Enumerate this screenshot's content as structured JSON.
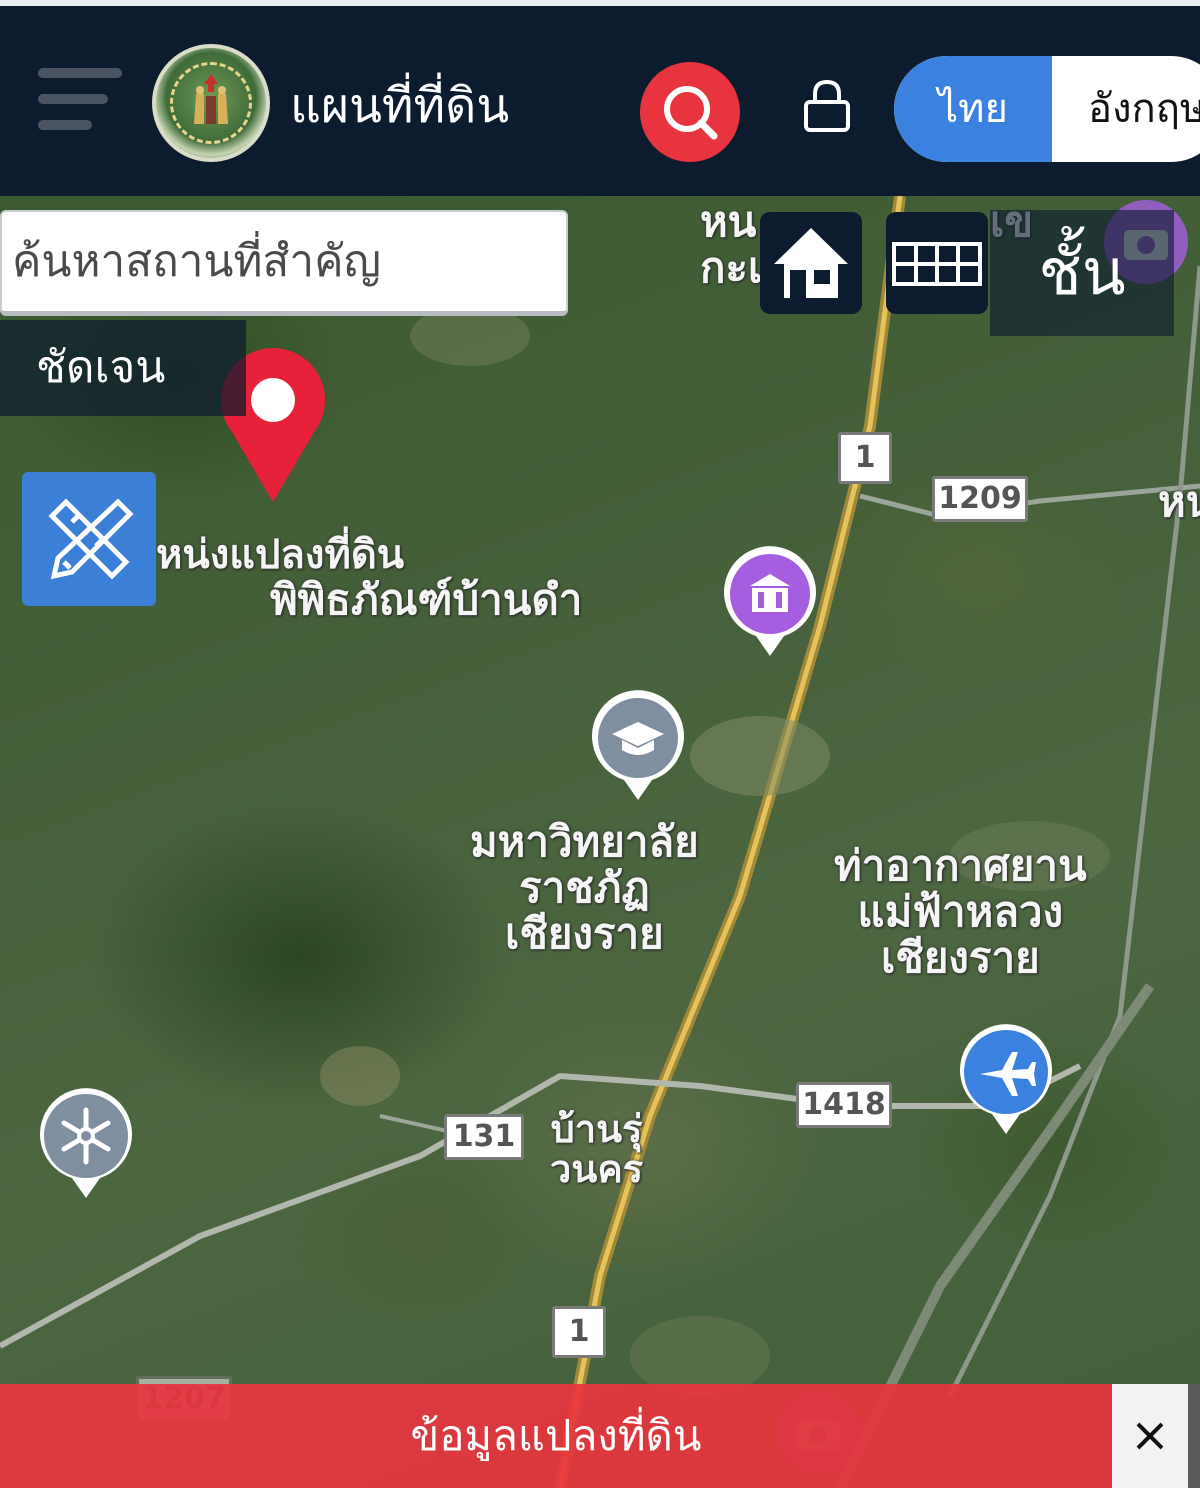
{
  "header": {
    "title": "แผนที่ที่ดิน",
    "logo_icon": "department-of-lands-seal",
    "search_icon": "search-icon",
    "lock_icon": "lock-icon",
    "language": {
      "active": "ไทย",
      "other": "อังกฤษ"
    }
  },
  "search": {
    "placeholder": "ค้นหาสถานที่สำคัญ"
  },
  "controls": {
    "clear_label": "ชัดเจน",
    "home_icon": "home-icon",
    "grid_icon": "grid-icon",
    "layers_label": "ชั้น",
    "measure_icon": "ruler-pencil-icon"
  },
  "map": {
    "pin_label": "หน่งแปลงที่ดิน",
    "labels": {
      "museum": "พิพิธภัณฑ์บ้านดำ",
      "university": [
        "มหาวิทยาลัย",
        "ราชภัฏ",
        "เชียงราย"
      ],
      "airport": [
        "ท่าอากาศยาน",
        "แม่ฟ้าหลวง",
        "เชียงราย"
      ],
      "village": [
        "บ้านรุ่",
        "วนคร"
      ],
      "top_partial": [
        "หน",
        "กะเ"
      ],
      "top_partial_right": "เข",
      "right_edge": "หน"
    },
    "road_shields": [
      "1",
      "1209",
      "1418",
      "131",
      "1",
      "1207"
    ],
    "poi_icons": [
      "museum-icon",
      "graduation-cap-icon",
      "airplane-icon",
      "snowflake-icon",
      "camera-icon"
    ],
    "colors": {
      "accent": "#e8343f",
      "primary": "#3b82e0",
      "header": "#0c1b2e"
    }
  },
  "bottom": {
    "label": "ข้อมูลแปลงที่ดิน",
    "close_icon": "close-icon"
  }
}
